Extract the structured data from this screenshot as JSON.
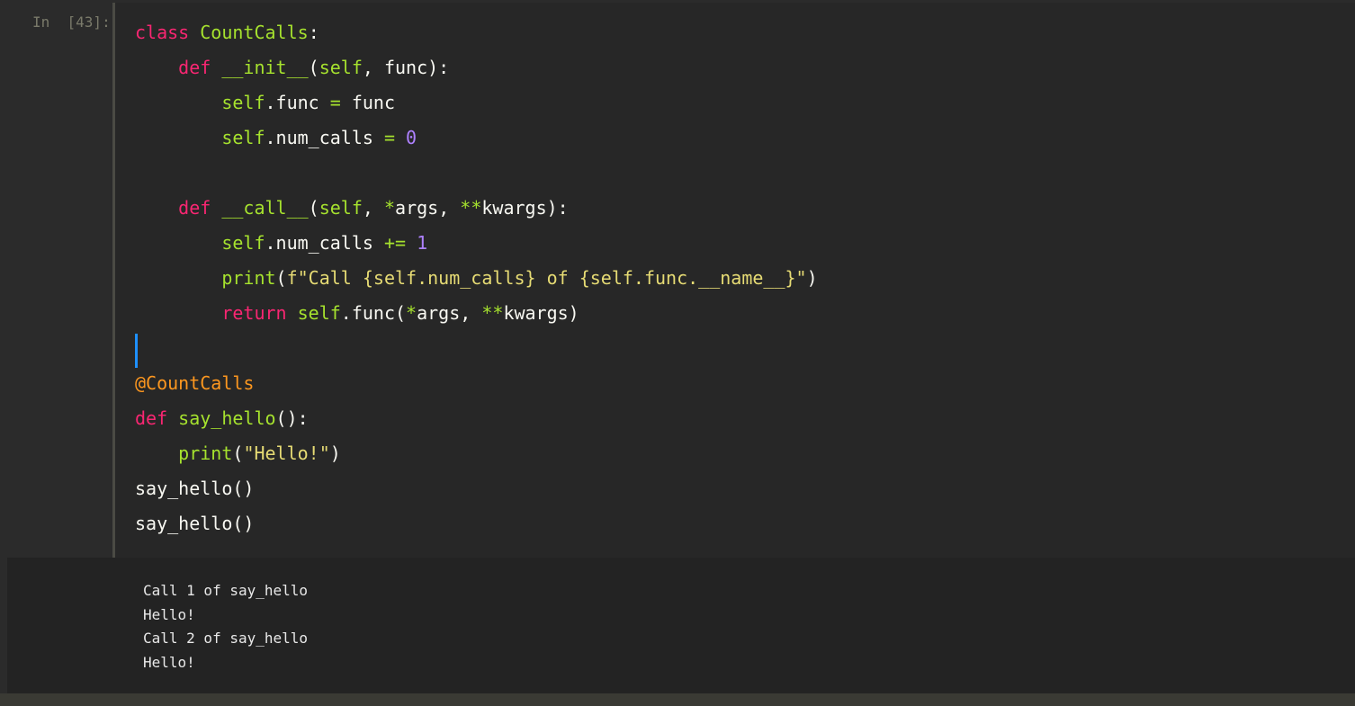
{
  "cell": {
    "prompt": "In  [43]:"
  },
  "code_lines": [
    [
      {
        "t": "kw",
        "v": "class"
      },
      {
        "t": "",
        "v": " "
      },
      {
        "t": "cls",
        "v": "CountCalls"
      },
      {
        "t": "",
        "v": ":"
      }
    ],
    [
      {
        "t": "",
        "v": "    "
      },
      {
        "t": "kw",
        "v": "def"
      },
      {
        "t": "",
        "v": " "
      },
      {
        "t": "fn",
        "v": "__init__"
      },
      {
        "t": "",
        "v": "("
      },
      {
        "t": "self",
        "v": "self"
      },
      {
        "t": "",
        "v": ", func):"
      }
    ],
    [
      {
        "t": "",
        "v": "        "
      },
      {
        "t": "self",
        "v": "self"
      },
      {
        "t": "",
        "v": ".func "
      },
      {
        "t": "op",
        "v": "="
      },
      {
        "t": "",
        "v": " func"
      }
    ],
    [
      {
        "t": "",
        "v": "        "
      },
      {
        "t": "self",
        "v": "self"
      },
      {
        "t": "",
        "v": ".num_calls "
      },
      {
        "t": "op",
        "v": "="
      },
      {
        "t": "",
        "v": " "
      },
      {
        "t": "num",
        "v": "0"
      }
    ],
    [],
    [
      {
        "t": "",
        "v": "    "
      },
      {
        "t": "kw",
        "v": "def"
      },
      {
        "t": "",
        "v": " "
      },
      {
        "t": "fn",
        "v": "__call__"
      },
      {
        "t": "",
        "v": "("
      },
      {
        "t": "self",
        "v": "self"
      },
      {
        "t": "",
        "v": ", "
      },
      {
        "t": "op",
        "v": "*"
      },
      {
        "t": "",
        "v": "args, "
      },
      {
        "t": "op",
        "v": "**"
      },
      {
        "t": "",
        "v": "kwargs):"
      }
    ],
    [
      {
        "t": "",
        "v": "        "
      },
      {
        "t": "self",
        "v": "self"
      },
      {
        "t": "",
        "v": ".num_calls "
      },
      {
        "t": "op",
        "v": "+="
      },
      {
        "t": "",
        "v": " "
      },
      {
        "t": "num",
        "v": "1"
      }
    ],
    [
      {
        "t": "",
        "v": "        "
      },
      {
        "t": "fn",
        "v": "print"
      },
      {
        "t": "",
        "v": "("
      },
      {
        "t": "str",
        "v": "f\"Call {self.num_calls} of {self.func.__name__}\""
      },
      {
        "t": "",
        "v": ")"
      }
    ],
    [
      {
        "t": "",
        "v": "        "
      },
      {
        "t": "kw",
        "v": "return"
      },
      {
        "t": "",
        "v": " "
      },
      {
        "t": "self",
        "v": "self"
      },
      {
        "t": "",
        "v": ".func("
      },
      {
        "t": "op",
        "v": "*"
      },
      {
        "t": "",
        "v": "args, "
      },
      {
        "t": "op",
        "v": "**"
      },
      {
        "t": "",
        "v": "kwargs)"
      }
    ],
    [],
    [
      {
        "t": "dec",
        "v": "@CountCalls"
      }
    ],
    [
      {
        "t": "kw",
        "v": "def"
      },
      {
        "t": "",
        "v": " "
      },
      {
        "t": "fn",
        "v": "say_hello"
      },
      {
        "t": "",
        "v": "():"
      }
    ],
    [
      {
        "t": "",
        "v": "    "
      },
      {
        "t": "fn",
        "v": "print"
      },
      {
        "t": "",
        "v": "("
      },
      {
        "t": "str",
        "v": "\"Hello!\""
      },
      {
        "t": "",
        "v": ")"
      }
    ],
    [
      {
        "t": "",
        "v": "say_hello()"
      }
    ],
    [
      {
        "t": "",
        "v": "say_hello()"
      }
    ]
  ],
  "output_lines": [
    "Call 1 of say_hello",
    "Hello!",
    "Call 2 of say_hello",
    "Hello!"
  ]
}
